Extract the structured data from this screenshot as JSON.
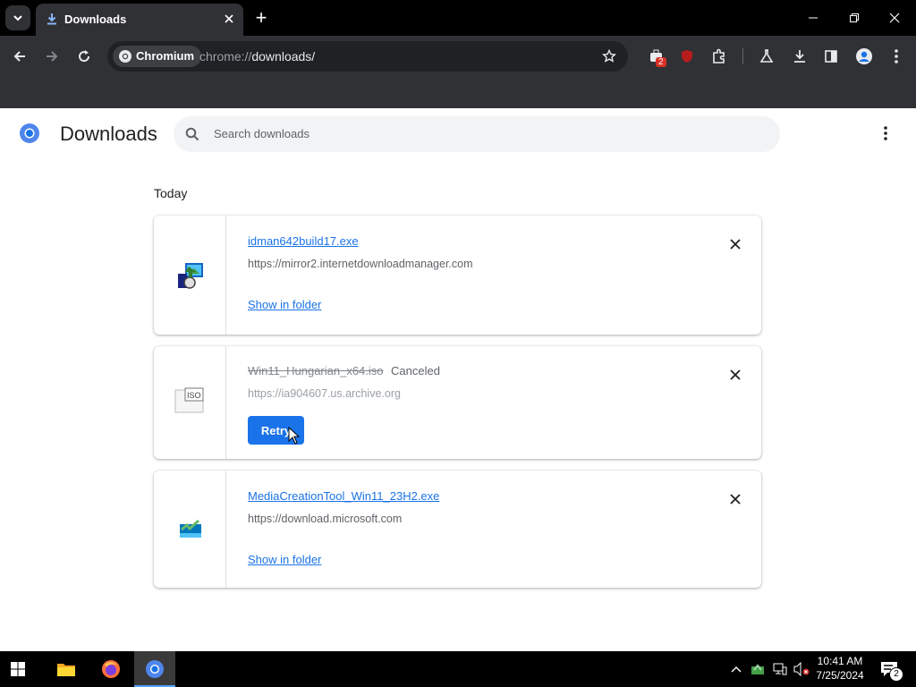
{
  "browser": {
    "tab_title": "Downloads",
    "new_tab_symbol": "+",
    "chip_label": "Chromium",
    "url_prefix": "chrome://",
    "url_path": "downloads/",
    "extension_badge": "2"
  },
  "page": {
    "title": "Downloads",
    "search_placeholder": "Search downloads",
    "section_label": "Today",
    "items": [
      {
        "file_name": "idman642build17.exe",
        "url": "https://mirror2.internetdownloadmanager.com",
        "action_label": "Show in folder",
        "icon": "idm-installer-icon"
      },
      {
        "file_name": "Win11_Hungarian_x64.iso",
        "status": "Canceled",
        "url": "https://ia904607.us.archive.org",
        "action_label": "Retry",
        "icon": "iso-file-icon"
      },
      {
        "file_name": "MediaCreationTool_Win11_23H2.exe",
        "url": "https://download.microsoft.com",
        "action_label": "Show in folder",
        "icon": "media-creation-tool-icon"
      }
    ]
  },
  "taskbar": {
    "time": "10:41 AM",
    "date": "7/25/2024",
    "notification_count": "2"
  },
  "colors": {
    "accent": "#1a73e8",
    "titlebar": "#000000",
    "toolbar": "#303134"
  }
}
